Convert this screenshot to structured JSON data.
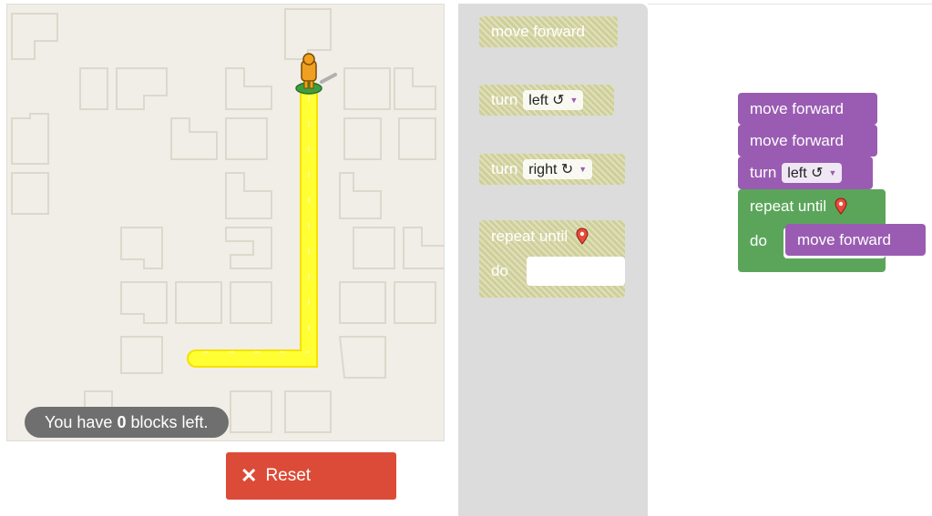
{
  "maze": {
    "status": {
      "prefix": "You have",
      "count": "0",
      "suffix": "blocks left."
    },
    "reset_label": "Reset",
    "reset_icon": "close-icon",
    "path_color": "#ffff00",
    "avatar_color": "#f0a020"
  },
  "toolbox": {
    "move_forward": "move forward",
    "turn_left": {
      "word": "turn",
      "dropdown": "left ↺"
    },
    "turn_right": {
      "word": "turn",
      "dropdown": "right ↻"
    },
    "repeat_until": {
      "label": "repeat until",
      "do": "do",
      "icon": "map-pin-icon"
    }
  },
  "workspace": {
    "blocks": [
      {
        "type": "move_forward",
        "label": "move forward"
      },
      {
        "type": "move_forward",
        "label": "move forward"
      },
      {
        "type": "turn",
        "word": "turn",
        "dropdown": "left ↺"
      },
      {
        "type": "repeat_until",
        "label": "repeat until",
        "do": "do",
        "inner": "move forward"
      }
    ]
  },
  "colors": {
    "motion": "#9a5cb2",
    "loop": "#5ba55b",
    "reset": "#dc4b38",
    "toolbox_block": "#cfcf9a"
  }
}
